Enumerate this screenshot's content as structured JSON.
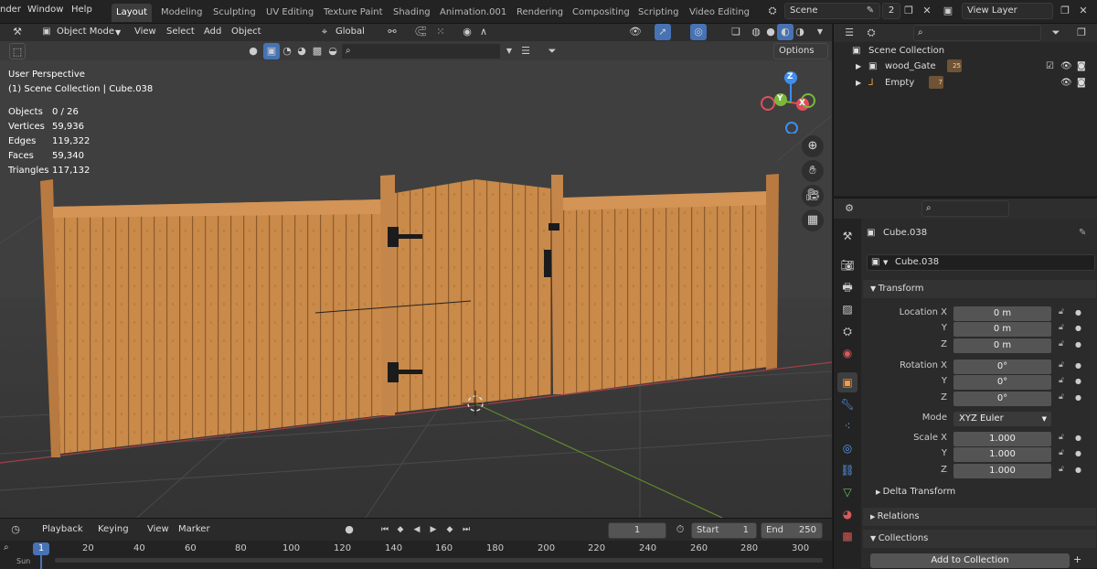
{
  "topbar": {
    "menus": [
      "nder",
      "Window",
      "Help"
    ],
    "workspaces": [
      "Layout",
      "Modeling",
      "Sculpting",
      "UV Editing",
      "Texture Paint",
      "Shading",
      "Animation.001",
      "Rendering",
      "Compositing",
      "Scripting",
      "Video Editing"
    ],
    "scene": "Scene",
    "scene_users": "2",
    "view_layer": "View Layer"
  },
  "viewport": {
    "mode": "Object Mode",
    "menus": [
      "View",
      "Select",
      "Add",
      "Object"
    ],
    "orientation": "Global",
    "options": "Options",
    "view_name": "User Perspective",
    "collection_info": "(1) Scene Collection | Cube.038",
    "stats": [
      {
        "label": "Objects",
        "value": "0 / 26"
      },
      {
        "label": "Vertices",
        "value": "59,936"
      },
      {
        "label": "Edges",
        "value": "119,322"
      },
      {
        "label": "Faces",
        "value": "59,340"
      },
      {
        "label": "Triangles",
        "value": "117,132"
      }
    ],
    "gizmo": {
      "x": "X",
      "y": "Y",
      "z": "Z"
    }
  },
  "outliner": {
    "root": "Scene Collection",
    "items": [
      {
        "name": "wood_Gate",
        "badge": "25"
      },
      {
        "name": "Empty",
        "badge": "7"
      }
    ]
  },
  "properties": {
    "object_name": "Cube.038",
    "datablock": "Cube.038",
    "transform_title": "Transform",
    "location": [
      {
        "label": "Location X",
        "value": "0 m"
      },
      {
        "label": "Y",
        "value": "0 m"
      },
      {
        "label": "Z",
        "value": "0 m"
      }
    ],
    "rotation": [
      {
        "label": "Rotation X",
        "value": "0°"
      },
      {
        "label": "Y",
        "value": "0°"
      },
      {
        "label": "Z",
        "value": "0°"
      }
    ],
    "mode_label": "Mode",
    "mode_value": "XYZ Euler",
    "scale": [
      {
        "label": "Scale X",
        "value": "1.000"
      },
      {
        "label": "Y",
        "value": "1.000"
      },
      {
        "label": "Z",
        "value": "1.000"
      }
    ],
    "delta_transform": "Delta Transform",
    "relations": "Relations",
    "collections": "Collections",
    "add_to_collection": "Add to Collection"
  },
  "timeline": {
    "menus": [
      "Playback",
      "Keying",
      "View",
      "Marker"
    ],
    "current_frame": "1",
    "start_label": "Start",
    "start": "1",
    "end_label": "End",
    "end": "250",
    "playhead": "1",
    "ticks": [
      "20",
      "40",
      "60",
      "80",
      "100",
      "120",
      "140",
      "160",
      "180",
      "200",
      "220",
      "240",
      "260",
      "280",
      "300"
    ],
    "summary": "Sun"
  },
  "colors": {
    "accent": "#4772b3",
    "axis_x": "#e04e5e",
    "axis_y": "#7ab83b",
    "axis_z": "#3d8ef0",
    "wood": "#c98a4a"
  }
}
